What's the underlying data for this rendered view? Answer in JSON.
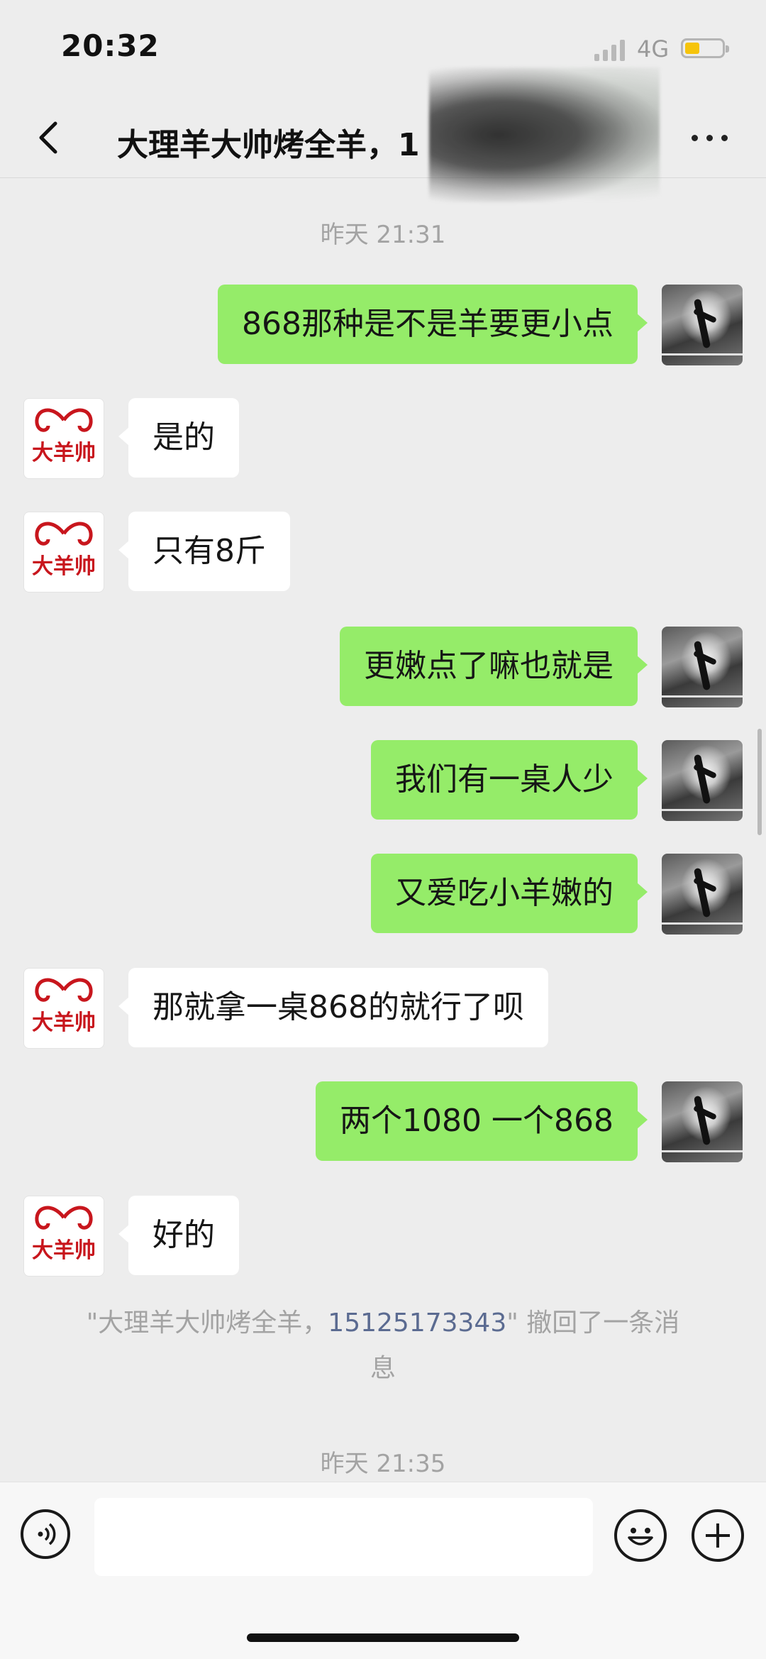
{
  "status_bar": {
    "time": "20:32",
    "network": "4G",
    "battery_level": 0.4,
    "battery_color": "#f6c40b"
  },
  "header": {
    "title": "大理羊大帅烤全羊，1",
    "back_icon": "chevron-left-icon",
    "more_icon": "more-dots-icon"
  },
  "theme": {
    "outgoing_bubble": "#95ec69",
    "incoming_bubble": "#ffffff",
    "background": "#ededed",
    "link_color": "#5b6b91"
  },
  "business_avatar": {
    "logo_text": "大羊帅",
    "logo_color": "#c8161d"
  },
  "chat": {
    "timestamp_1": "昨天 21:31",
    "messages": [
      {
        "side": "me",
        "text": "868那种是不是羊要更小点"
      },
      {
        "side": "them",
        "text": "是的"
      },
      {
        "side": "them",
        "text": "只有8斤"
      },
      {
        "side": "me",
        "text": "更嫩点了嘛也就是"
      },
      {
        "side": "me",
        "text": "我们有一桌人少"
      },
      {
        "side": "me",
        "text": "又爱吃小羊嫩的"
      },
      {
        "side": "them",
        "text": "那就拿一桌868的就行了呗"
      },
      {
        "side": "me",
        "text": "两个1080  一个868"
      },
      {
        "side": "them",
        "text": "好的"
      }
    ],
    "recall_notice": {
      "prefix": "\"大理羊大帅烤全羊，",
      "phone": "15125173343",
      "suffix_line1": "\" 撤回了一条消",
      "suffix_line2": "息"
    },
    "timestamp_2": "昨天 21:35"
  },
  "input_bar": {
    "voice_icon": "voice-icon",
    "emoji_icon": "emoji-icon",
    "plus_icon": "plus-icon",
    "value": ""
  }
}
